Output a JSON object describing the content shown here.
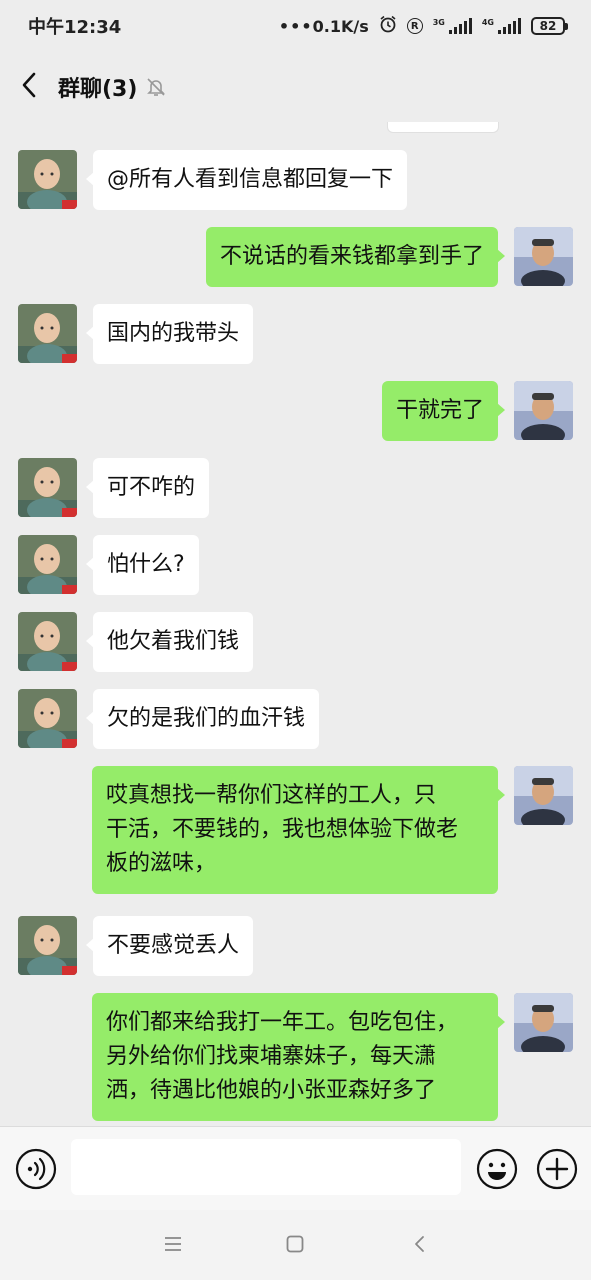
{
  "status_bar": {
    "time": "中午12:34",
    "network_speed": "0.1K/s",
    "sim1_tag": "3G",
    "sim2_tag": "4G",
    "battery": "82"
  },
  "header": {
    "title": "群聊(3)"
  },
  "messages": [
    {
      "side": "left",
      "text": "@所有人看到信息都回复一下"
    },
    {
      "side": "right",
      "text": "不说话的看来钱都拿到手了"
    },
    {
      "side": "left",
      "text": "国内的我带头"
    },
    {
      "side": "right",
      "text": "干就完了"
    },
    {
      "side": "left",
      "text": "可不咋的"
    },
    {
      "side": "left",
      "text": "怕什么?"
    },
    {
      "side": "left",
      "text": "他欠着我们钱"
    },
    {
      "side": "left",
      "text": "欠的是我们的血汗钱"
    },
    {
      "side": "right",
      "lines": [
        "哎真想找一帮你们这样的工人，只",
        "干活，不要钱的，我也想体验下做老",
        "板的滋味，"
      ]
    },
    {
      "side": "left",
      "text": "不要感觉丢人"
    },
    {
      "side": "right",
      "lines": [
        "你们都来给我打一年工。包吃包住，",
        "另外给你们找柬埔寨妹子，每天潇",
        "洒，待遇比他娘的小张亚森好多了"
      ]
    }
  ],
  "input": {
    "value": "",
    "placeholder": ""
  },
  "icons": {
    "back": "chevron-left-icon",
    "mute": "bell-off-icon",
    "voice": "voice-icon",
    "emoji": "smile-icon",
    "plus": "plus-icon",
    "nav_menu": "menu-icon",
    "nav_home": "home-square-icon",
    "nav_back": "nav-back-icon"
  },
  "colors": {
    "background": "#ededed",
    "bubble_self": "#95ec69",
    "bubble_other": "#ffffff"
  }
}
